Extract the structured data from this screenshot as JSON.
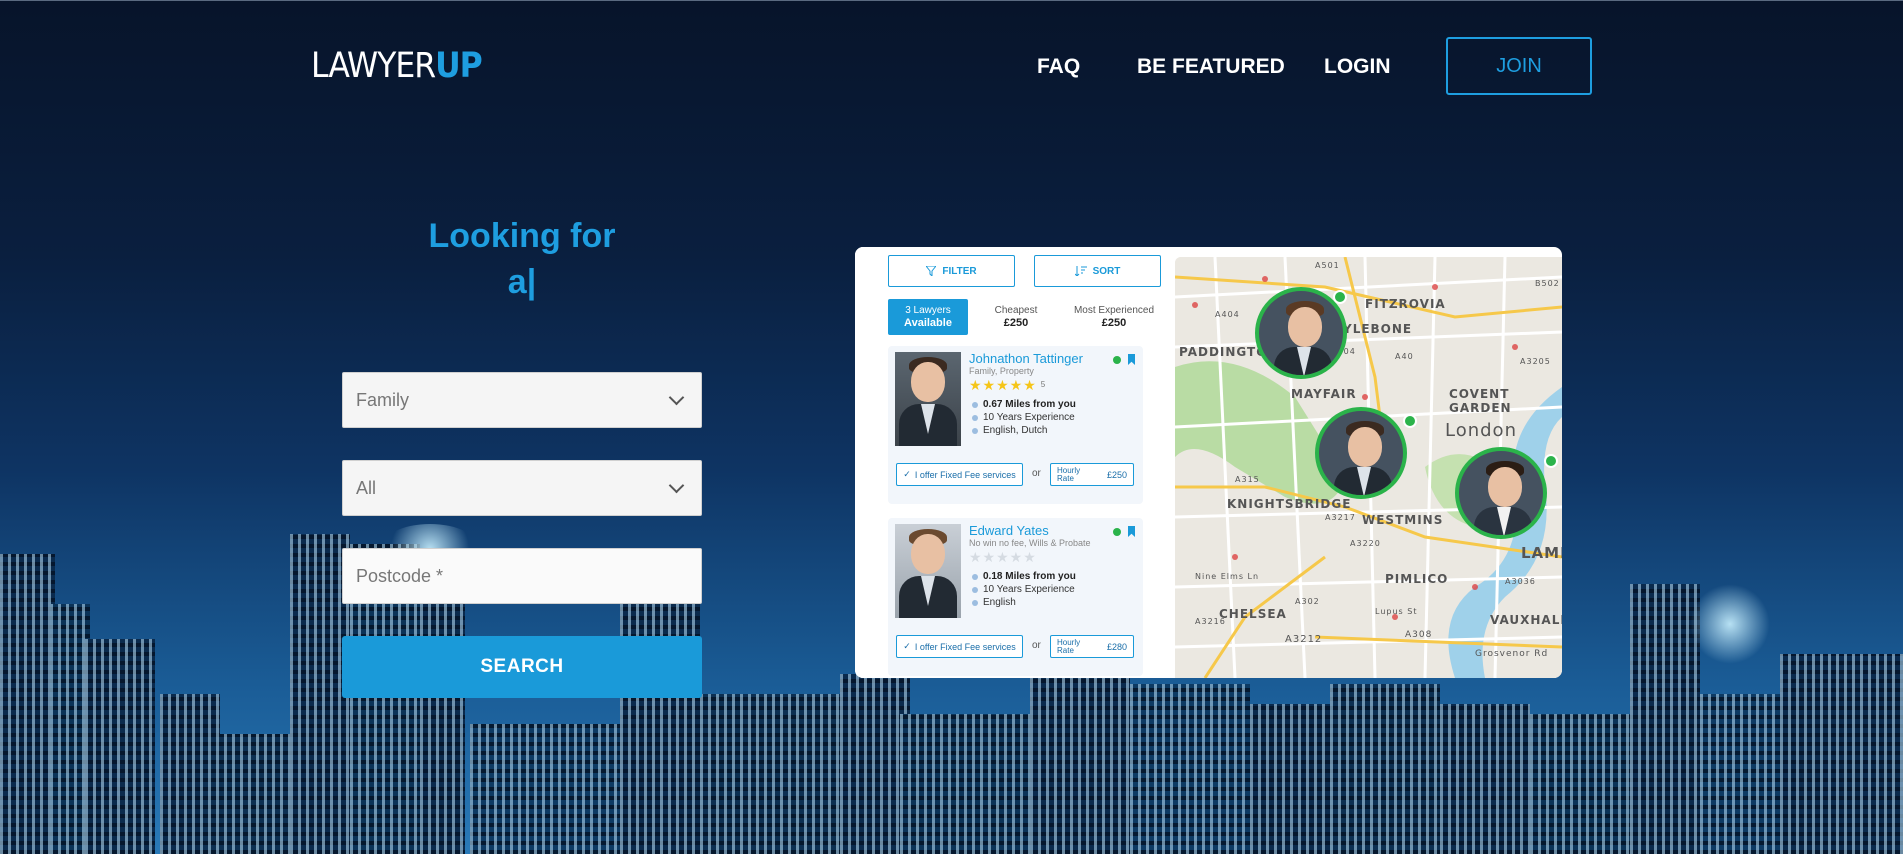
{
  "header": {
    "logo_main": "LAWYER",
    "logo_accent": "UP",
    "nav": [
      "FAQ",
      "BE FEATURED",
      "LOGIN"
    ],
    "join_label": "JOIN"
  },
  "hero": {
    "line1": "Looking for",
    "line2": "a|"
  },
  "form": {
    "category_value": "Family",
    "subcategory_value": "All",
    "postcode_placeholder": "Postcode *",
    "search_label": "SEARCH"
  },
  "preview": {
    "filter_label": "FILTER",
    "sort_label": "SORT",
    "tabs": [
      {
        "line1": "3 Lawyers",
        "line2": "Available"
      },
      {
        "line1": "Cheapest",
        "line2": "£250"
      },
      {
        "line1": "Most Experienced",
        "line2": "£250"
      }
    ],
    "cards": [
      {
        "name": "Johnathon Tattinger",
        "specialty": "Family, Property",
        "rating": "5",
        "distance": "0.67 Miles from you",
        "experience": "10 Years Experience",
        "languages": "English, Dutch",
        "fee_label": "I offer Fixed Fee services",
        "or": "or",
        "rate_label": "Hourly Rate",
        "rate_value": "£250"
      },
      {
        "name": "Edward Yates",
        "specialty": "No win no fee, Wills & Probate",
        "rating": "",
        "distance": "0.18 Miles from you",
        "experience": "10 Years Experience",
        "languages": "English",
        "fee_label": "I offer Fixed Fee services",
        "or": "or",
        "rate_label": "Hourly Rate",
        "rate_value": "£280"
      }
    ],
    "map_labels": [
      "FITZROVIA",
      "YLEBONE",
      "PADDINGTO",
      "MAYFAIR",
      "COVENT GARDEN",
      "London",
      "KNIGHTSBRIDGE",
      "WESTMINS",
      "LAMBE",
      "PIMLICO",
      "CHELSEA",
      "VAUXHALL",
      "A501",
      "A404",
      "A5204",
      "A40",
      "A315",
      "A3212",
      "A308",
      "Grosvenor Rd",
      "Nine Elms Ln",
      "A3216",
      "A302",
      "A3220",
      "Lupus St",
      "B502",
      "A3205",
      "A3217",
      "A3036"
    ]
  },
  "colors": {
    "accent": "#1e9ee0",
    "online": "#2bb34a"
  }
}
